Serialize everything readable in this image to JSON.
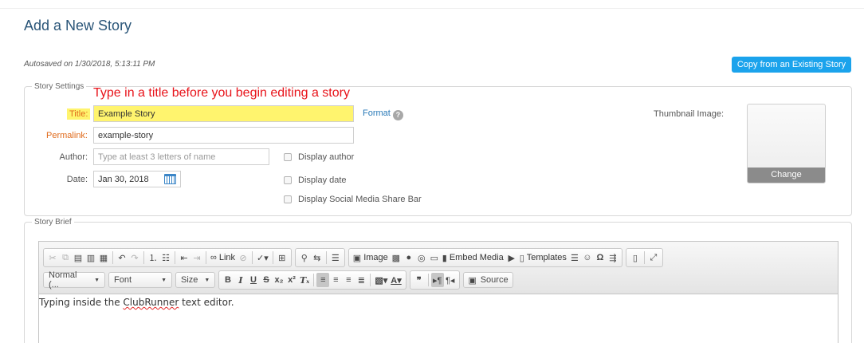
{
  "page": {
    "title": "Add a New Story"
  },
  "autosave": {
    "text": "Autosaved on 1/30/2018, 5:13:11 PM"
  },
  "copy_button": {
    "label": "Copy from an Existing Story",
    "color": "#1ba3ec"
  },
  "hint": {
    "text": "Type in a title before you begin editing a story",
    "color": "#e8131a"
  },
  "settings": {
    "legend": "Story Settings",
    "title_label": "Title:",
    "title_value": "Example Story",
    "format_link": "Format",
    "permalink_label": "Permalink:",
    "permalink_value": "example-story",
    "author_label": "Author:",
    "author_placeholder": "Type at least 3 letters of name",
    "date_label": "Date:",
    "date_value": "Jan 30, 2018",
    "checkboxes": {
      "display_author": "Display author",
      "display_date": "Display date",
      "display_share": "Display Social Media Share Bar"
    },
    "thumbnail_label": "Thumbnail Image:",
    "thumbnail_change": "Change"
  },
  "brief": {
    "legend": "Story Brief",
    "toolbar": {
      "link": "Link",
      "image": "Image",
      "embed_media": "Embed Media",
      "templates": "Templates",
      "format_combo": "Normal (...",
      "font_combo": "Font",
      "size_combo": "Size",
      "source": "Source"
    },
    "content_prefix": "Typing inside the ",
    "content_misspelled": "ClubRunner",
    "content_suffix": " text editor."
  },
  "icons": [
    "cut-icon",
    "copy-icon",
    "paste-icon",
    "paste-text-icon",
    "paste-word-icon",
    "undo-icon",
    "redo-icon",
    "numbered-list-icon",
    "bulleted-list-icon",
    "outdent-icon",
    "indent-icon",
    "link-icon",
    "unlink-icon",
    "spellcheck-icon",
    "table-icon",
    "find-icon",
    "replace-icon",
    "page-break-icon",
    "image-icon",
    "gallery-icon",
    "flash-icon",
    "iframe-icon",
    "form-icon",
    "embed-media-icon",
    "video-icon",
    "templates-icon",
    "horizontal-rule-icon",
    "smiley-icon",
    "special-char-icon",
    "show-blocks-icon",
    "preview-icon",
    "maximize-icon",
    "calendar-icon",
    "help-icon"
  ]
}
